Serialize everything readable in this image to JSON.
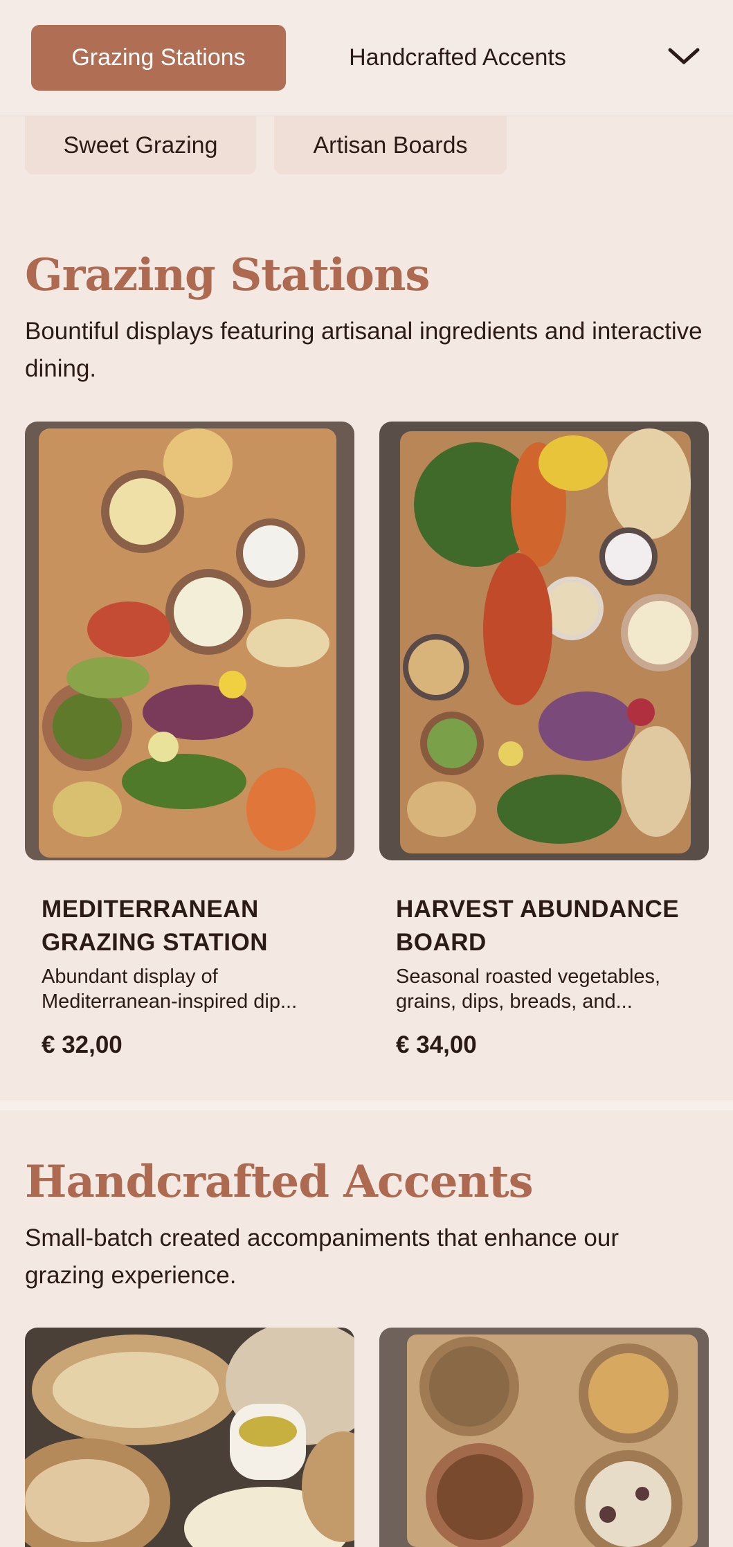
{
  "nav": {
    "tabs": [
      {
        "label": "Grazing Stations",
        "active": true
      },
      {
        "label": "Handcrafted Accents",
        "active": false
      }
    ],
    "more_icon": "chevron-down-icon",
    "chips": [
      "Sweet Grazing",
      "Artisan Boards"
    ]
  },
  "sections": [
    {
      "title": "Grazing Stations",
      "description": "Bountiful displays featuring artisanal ingredients and interactive dining.",
      "products": [
        {
          "name": "MEDITERRANEAN GRAZING STATION",
          "description": "Abundant display of Mediterranean-inspired dip...",
          "price": "€ 32,00"
        },
        {
          "name": "HARVEST ABUNDANCE BOARD",
          "description": "Seasonal roasted vegetables, grains, dips, breads, and...",
          "price": "€ 34,00"
        }
      ]
    },
    {
      "title": "Handcrafted Accents",
      "description": "Small-batch created accompaniments that enhance our grazing experience.",
      "products": []
    }
  ],
  "colors": {
    "accent": "#b06e55",
    "background": "#f3e8e2",
    "text": "#2b1b16"
  }
}
